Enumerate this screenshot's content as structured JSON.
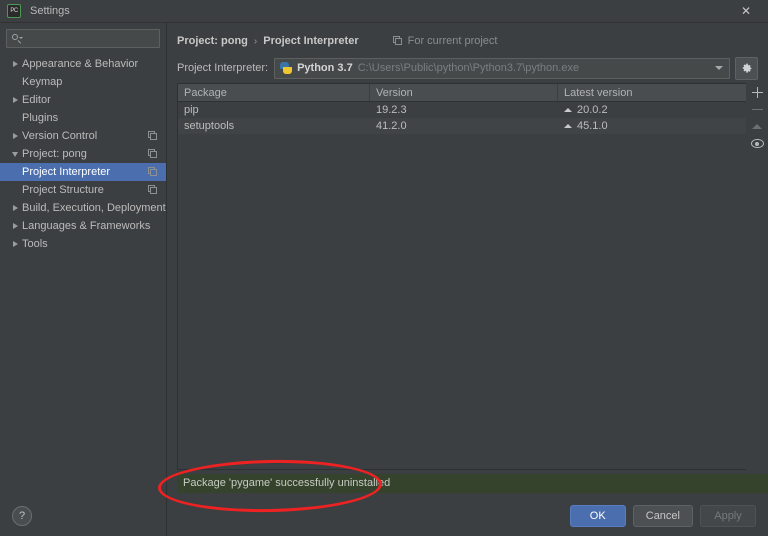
{
  "window": {
    "title": "Settings",
    "app_icon": "pycharm-icon",
    "close_label": "✕"
  },
  "search": {
    "placeholder": "",
    "value": "",
    "icon": "search-icon"
  },
  "sidebar": {
    "items": [
      {
        "label": "Appearance & Behavior",
        "level": 0,
        "arrow": "right",
        "module_icon": false,
        "selected": false
      },
      {
        "label": "Keymap",
        "level": 0,
        "arrow": "none",
        "module_icon": false,
        "selected": false
      },
      {
        "label": "Editor",
        "level": 0,
        "arrow": "right",
        "module_icon": false,
        "selected": false
      },
      {
        "label": "Plugins",
        "level": 0,
        "arrow": "none",
        "module_icon": false,
        "selected": false
      },
      {
        "label": "Version Control",
        "level": 0,
        "arrow": "right",
        "module_icon": true,
        "selected": false
      },
      {
        "label": "Project: pong",
        "level": 0,
        "arrow": "down",
        "module_icon": true,
        "selected": false
      },
      {
        "label": "Project Interpreter",
        "level": 1,
        "arrow": "none",
        "module_icon": true,
        "selected": true
      },
      {
        "label": "Project Structure",
        "level": 1,
        "arrow": "none",
        "module_icon": true,
        "selected": false
      },
      {
        "label": "Build, Execution, Deployment",
        "level": 0,
        "arrow": "right",
        "module_icon": false,
        "selected": false
      },
      {
        "label": "Languages & Frameworks",
        "level": 0,
        "arrow": "right",
        "module_icon": false,
        "selected": false
      },
      {
        "label": "Tools",
        "level": 0,
        "arrow": "right",
        "module_icon": false,
        "selected": false
      }
    ],
    "help_label": "?"
  },
  "breadcrumb": {
    "parent": "Project: pong",
    "separator": "›",
    "current": "Project Interpreter",
    "scope_label": "For current project",
    "scope_icon": "module-icon"
  },
  "interpreter": {
    "label": "Project Interpreter:",
    "icon": "python-icon",
    "name": "Python 3.7",
    "path": "C:\\Users\\Public\\python\\Python3.7\\python.exe",
    "dropdown_icon": "chevron-down-icon",
    "gear_icon": "gear-icon"
  },
  "packages": {
    "columns": [
      "Package",
      "Version",
      "Latest version"
    ],
    "rows": [
      {
        "package": "pip",
        "version": "19.2.3",
        "latest": "20.0.2",
        "has_upgrade": true
      },
      {
        "package": "setuptools",
        "version": "41.2.0",
        "latest": "45.1.0",
        "has_upgrade": true
      }
    ],
    "toolbar": [
      {
        "name": "install-package-button",
        "icon": "plus-icon",
        "enabled": true
      },
      {
        "name": "uninstall-package-button",
        "icon": "minus-icon",
        "enabled": false
      },
      {
        "name": "upgrade-package-button",
        "icon": "up-triangle-icon",
        "enabled": false
      },
      {
        "name": "show-early-releases-button",
        "icon": "eye-icon",
        "enabled": true
      }
    ]
  },
  "status": {
    "message": "Package 'pygame' successfully uninstalled",
    "background_color": "#35432c",
    "text_color": "#c7cbc2"
  },
  "annotation": {
    "shape": "ellipse",
    "color": "#ee2222"
  },
  "buttons": {
    "ok": "OK",
    "cancel": "Cancel",
    "apply": "Apply",
    "apply_enabled": false
  },
  "colors": {
    "background": "#3c3f41",
    "selection": "#4b6eaf",
    "accent": "#4b6eaf",
    "status_green": "#35432c",
    "annotation_red": "#ee2222"
  }
}
